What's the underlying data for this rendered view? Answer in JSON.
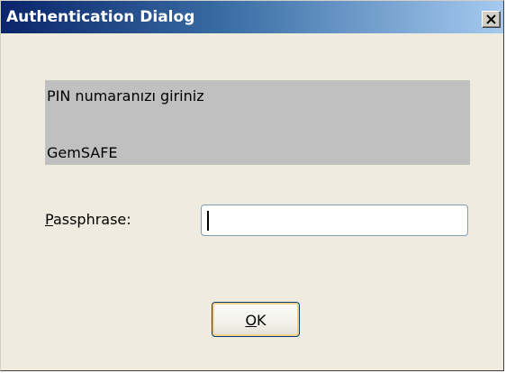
{
  "window": {
    "title": "Authentication Dialog"
  },
  "message": {
    "line1": "PIN numaranızı giriniz",
    "line2": "GemSAFE"
  },
  "passphrase": {
    "label_mnemonic": "P",
    "label_rest": "assphrase:",
    "value": ""
  },
  "ok_button": {
    "label_mnemonic": "O",
    "label_rest": "K"
  },
  "icons": {
    "close": "close-icon"
  },
  "colors": {
    "titlebar_start": "#0a246a",
    "titlebar_end": "#a6caf0",
    "dialog_background": "#efebde",
    "message_panel": "#c0c0c0"
  }
}
